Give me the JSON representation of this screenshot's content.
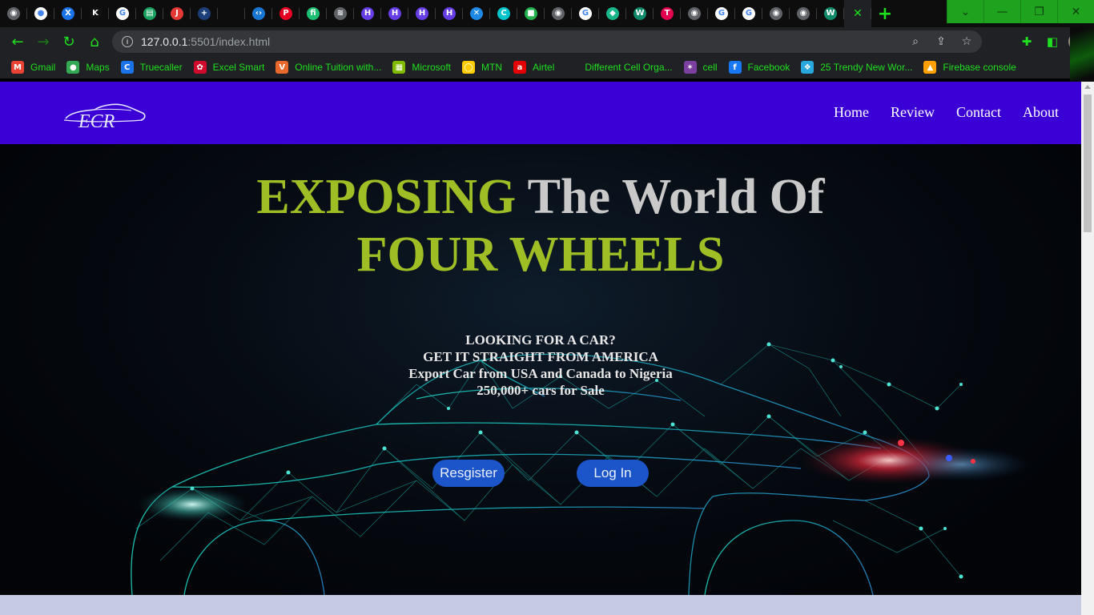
{
  "browser": {
    "tabs": [
      {
        "icon": "globe-icon",
        "bg": "#5f6368",
        "glyph": "◉"
      },
      {
        "icon": "github-icon",
        "bg": "#ffffff",
        "glyph": "●"
      },
      {
        "icon": "x-brand-icon",
        "bg": "#1a73e8",
        "glyph": "X"
      },
      {
        "icon": "k-icon",
        "bg": "#111111",
        "glyph": "K"
      },
      {
        "icon": "google-icon",
        "bg": "#ffffff",
        "glyph": "G"
      },
      {
        "icon": "sheet-icon",
        "bg": "#1aa260",
        "glyph": "▤"
      },
      {
        "icon": "j-icon",
        "bg": "#e53935",
        "glyph": "J"
      },
      {
        "icon": "plus-blue-icon",
        "bg": "#1c3f7a",
        "glyph": "+"
      },
      {
        "icon": "blank-icon",
        "bg": "#0d0d0d",
        "glyph": ""
      },
      {
        "icon": "code-icon",
        "bg": "#1976d2",
        "glyph": "‹›"
      },
      {
        "icon": "pinterest-icon",
        "bg": "#e60023",
        "glyph": "P"
      },
      {
        "icon": "fiverr-icon",
        "bg": "#1dbf73",
        "glyph": "fi"
      },
      {
        "icon": "layers-icon",
        "bg": "#5f6368",
        "glyph": "≋"
      },
      {
        "icon": "hostinger-icon",
        "bg": "#673de6",
        "glyph": "H"
      },
      {
        "icon": "hostinger-icon",
        "bg": "#673de6",
        "glyph": "H"
      },
      {
        "icon": "hostinger-icon",
        "bg": "#673de6",
        "glyph": "H"
      },
      {
        "icon": "hostinger-icon",
        "bg": "#673de6",
        "glyph": "H"
      },
      {
        "icon": "x-square-icon",
        "bg": "#1e88e5",
        "glyph": "✕"
      },
      {
        "icon": "canva-icon",
        "bg": "#00c4cc",
        "glyph": "C"
      },
      {
        "icon": "green-square-icon",
        "bg": "#22b14c",
        "glyph": "■"
      },
      {
        "icon": "globe-icon",
        "bg": "#5f6368",
        "glyph": "◉"
      },
      {
        "icon": "google-icon",
        "bg": "#ffffff",
        "glyph": "G"
      },
      {
        "icon": "tag-icon",
        "bg": "#19b58a",
        "glyph": "◆"
      },
      {
        "icon": "w-icon",
        "bg": "#0f8a6a",
        "glyph": "W"
      },
      {
        "icon": "red-hex-icon",
        "bg": "#e3004f",
        "glyph": "T"
      },
      {
        "icon": "globe-icon",
        "bg": "#5f6368",
        "glyph": "◉"
      },
      {
        "icon": "google-icon",
        "bg": "#ffffff",
        "glyph": "G"
      },
      {
        "icon": "google-icon",
        "bg": "#ffffff",
        "glyph": "G"
      },
      {
        "icon": "globe-icon",
        "bg": "#5f6368",
        "glyph": "◉"
      },
      {
        "icon": "globe-icon",
        "bg": "#5f6368",
        "glyph": "◉"
      },
      {
        "icon": "w-icon",
        "bg": "#0f8a6a",
        "glyph": "W"
      }
    ],
    "active_tab_glyph": "✕",
    "new_tab_glyph": "+",
    "window_controls": [
      "⌄",
      "—",
      "❐",
      "✕"
    ],
    "url_host": "127.0.0.1",
    "url_rest": ":5501/index.html",
    "bookmarks": [
      {
        "label": "Gmail",
        "icon": "gmail-icon",
        "bg": "#ea4335",
        "glyph": "M"
      },
      {
        "label": "Maps",
        "icon": "maps-pin-icon",
        "bg": "#34a853",
        "glyph": "●"
      },
      {
        "label": "Truecaller",
        "icon": "truecaller-icon",
        "bg": "#1a73e8",
        "glyph": "C"
      },
      {
        "label": "Excel Smart",
        "icon": "huawei-icon",
        "bg": "#cf0a2c",
        "glyph": "✿"
      },
      {
        "label": "Online Tuition with...",
        "icon": "v-icon",
        "bg": "#e8672b",
        "glyph": "V"
      },
      {
        "label": "Microsoft",
        "icon": "microsoft-icon",
        "bg": "#7fba00",
        "glyph": "▦"
      },
      {
        "label": "MTN",
        "icon": "mtn-icon",
        "bg": "#ffcc00",
        "glyph": "◯"
      },
      {
        "label": "Airtel",
        "icon": "airtel-icon",
        "bg": "#e40000",
        "glyph": "a"
      },
      {
        "label": "Different Cell Orga...",
        "icon": "blank-bookmark-icon",
        "bg": "#202124",
        "glyph": ""
      },
      {
        "label": "cell",
        "icon": "cell-icon",
        "bg": "#7b3fa0",
        "glyph": "✶"
      },
      {
        "label": "Facebook",
        "icon": "facebook-icon",
        "bg": "#1877f2",
        "glyph": "f"
      },
      {
        "label": "25 Trendy New Wor...",
        "icon": "bird-icon",
        "bg": "#29a8e0",
        "glyph": "❖"
      },
      {
        "label": "Firebase console",
        "icon": "firebase-icon",
        "bg": "#ffa000",
        "glyph": "▲"
      }
    ]
  },
  "site": {
    "nav": [
      "Home",
      "Review",
      "Contact",
      "About"
    ],
    "logo_text": "ECR",
    "headline_word1": "EXPOSING",
    "headline_rest": " The World Of",
    "headline_line2": "FOUR WHEELS",
    "tagline": [
      "LOOKING FOR A CAR?",
      "GET IT STRAIGHT FROM AMERICA",
      "Export Car from USA and Canada to Nigeria",
      "250,000+ cars for Sale"
    ],
    "register_label": "Resgister",
    "login_label": "Log In"
  },
  "colors": {
    "nav_bg": "#3a00d6",
    "accent_green": "#9fbd24",
    "headline_gray": "#c9c9c9",
    "button_blue": "#1c55c9",
    "chrome_green": "#1ee01e"
  }
}
